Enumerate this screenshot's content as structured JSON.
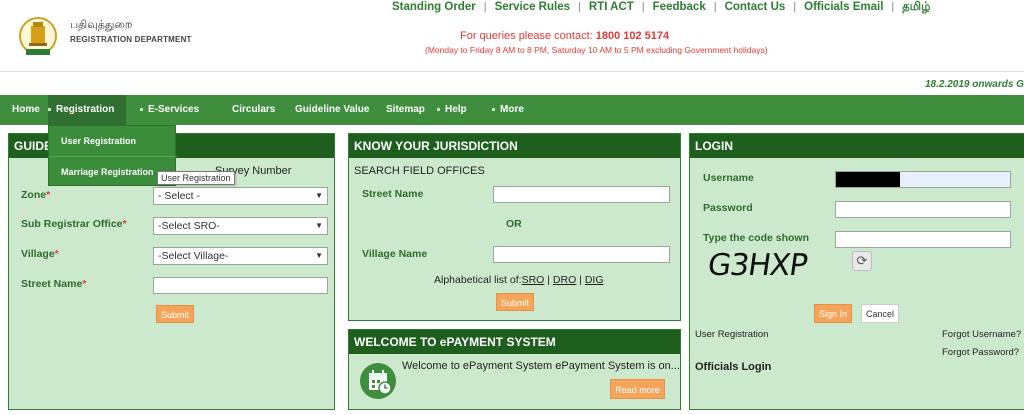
{
  "header": {
    "brand_ta": "பதிவுத்துறை",
    "brand_en": "REGISTRATION DEPARTMENT",
    "top_links": [
      "Standing Order",
      "Service Rules",
      "RTI ACT",
      "Feedback",
      "Contact Us",
      "Officials Email",
      "தமிழ்"
    ],
    "query_prefix": "For queries please contact:",
    "query_phone": "1800 102 5174",
    "query_hours": "(Monday to Friday 8 AM to 8 PM, Saturday 10 AM to 5 PM excluding Government holidays)",
    "marquee": "18.2.2019 onwards G"
  },
  "menu": {
    "items": [
      "Home",
      "Registration",
      "E-Services",
      "Circulars",
      "Guideline Value",
      "Sitemap",
      "Help",
      "More"
    ],
    "dropdown": [
      "User Registration",
      "Marriage Registration"
    ],
    "tooltip": "User Registration"
  },
  "guideline": {
    "title": "GUIDE",
    "survey_text": "Survey Number",
    "zone_label": "Zone",
    "zone_value": "- Select -",
    "sro_label": "Sub Registrar Office",
    "sro_value": "-Select SRO-",
    "village_label": "Village",
    "village_value": "-Select Village-",
    "street_label": "Street Name",
    "req_mark": "*",
    "submit": "Submit"
  },
  "jurisdiction": {
    "title": "KNOW YOUR JURISDICTION",
    "subtitle": "SEARCH FIELD OFFICES",
    "street_label": "Street Name",
    "or": "OR",
    "village_label": "Village Name",
    "alpha_prefix": "Alphabetical list of:",
    "links": [
      "SRO",
      "DRO",
      "DIG"
    ],
    "sep": "|",
    "submit": "Submit"
  },
  "epayment": {
    "title": "WELCOME TO ePAYMENT SYSTEM",
    "text": "Welcome to ePayment System ePayment System is on...",
    "read_more": "Read more"
  },
  "login": {
    "title": "LOGIN",
    "username_label": "Username",
    "password_label": "Password",
    "code_label": "Type the code shown",
    "captcha": "G3HXP",
    "signin": "Sign In",
    "cancel": "Cancel",
    "user_reg": "User Registration",
    "forgot_user": "Forgot Username?",
    "forgot_pass": "Forgot Password?",
    "officials": "Officials Login"
  },
  "colors": {
    "menu_green": "#3e8e3e",
    "panel_head": "#1e5f1e",
    "panel_bg": "#cde9cd",
    "label_green": "#2e6b2e",
    "button_orange": "#f5a55a",
    "alert_red": "#e53935"
  }
}
